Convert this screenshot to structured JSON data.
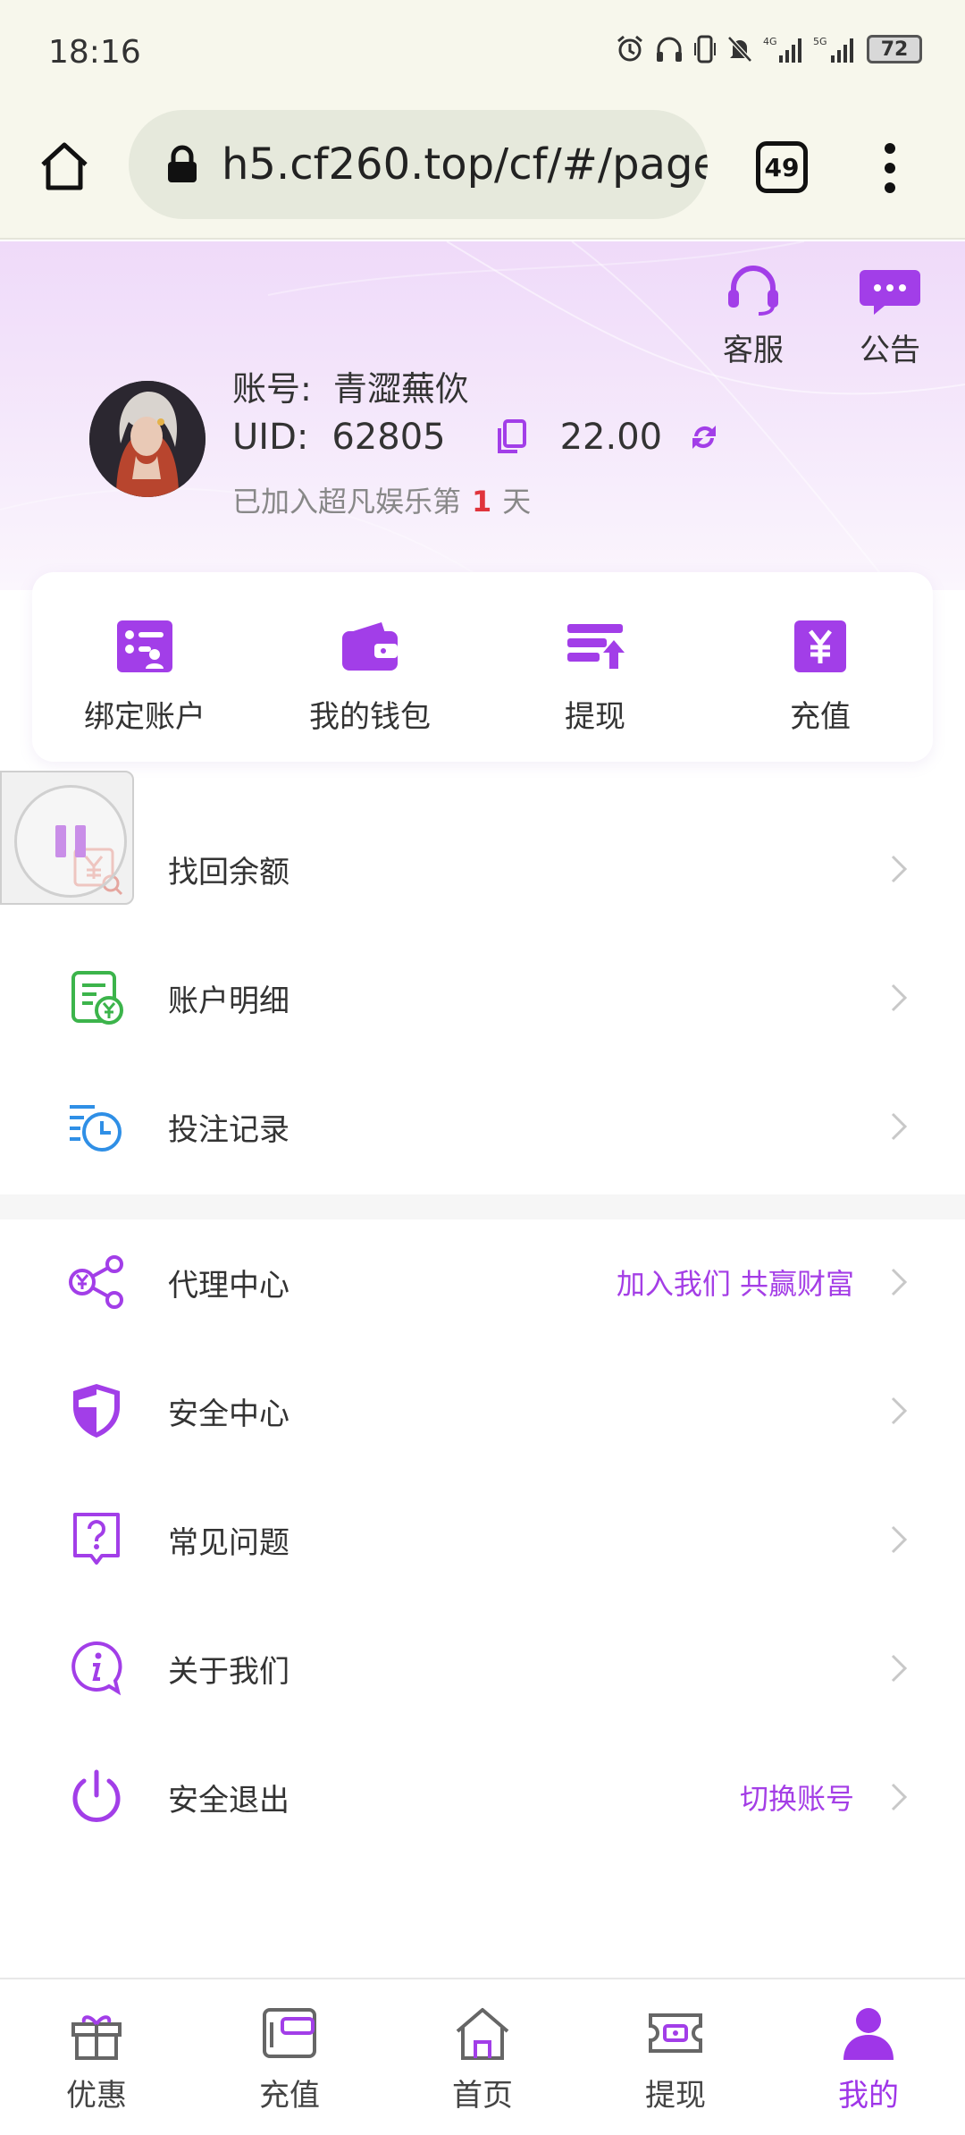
{
  "status_bar": {
    "time": "18:16",
    "network_1": "4G",
    "network_2": "5G",
    "battery": "72"
  },
  "browser": {
    "url": "h5.cf260.top/cf/#/page",
    "tab_count": "49"
  },
  "header_actions": [
    {
      "label": "客服",
      "icon": "headset-icon"
    },
    {
      "label": "公告",
      "icon": "chat-bubble-icon"
    }
  ],
  "profile": {
    "account_label": "账号:",
    "account_name": "青澀蕪佽",
    "uid_label": "UID:",
    "uid_value": "62805",
    "balance": "22.00",
    "joined_prefix": "已加入超凡娱乐第",
    "joined_days": "1",
    "joined_suffix": "天"
  },
  "quick_actions": [
    {
      "label": "绑定账户",
      "icon": "bind-account-icon"
    },
    {
      "label": "我的钱包",
      "icon": "wallet-icon"
    },
    {
      "label": "提现",
      "icon": "withdraw-icon"
    },
    {
      "label": "充值",
      "icon": "yen-card-icon"
    }
  ],
  "menu_group_1": [
    {
      "label": "找回余额",
      "icon": "recover-balance-icon",
      "extra": ""
    },
    {
      "label": "账户明细",
      "icon": "account-detail-icon",
      "extra": ""
    },
    {
      "label": "投注记录",
      "icon": "bet-record-icon",
      "extra": ""
    }
  ],
  "menu_group_2": [
    {
      "label": "代理中心",
      "icon": "agent-network-icon",
      "extra": "加入我们 共赢财富"
    },
    {
      "label": "安全中心",
      "icon": "shield-icon",
      "extra": ""
    },
    {
      "label": "常见问题",
      "icon": "question-icon",
      "extra": ""
    },
    {
      "label": "关于我们",
      "icon": "info-icon",
      "extra": ""
    },
    {
      "label": "安全退出",
      "icon": "power-icon",
      "extra": "切换账号"
    }
  ],
  "bottom_nav": [
    {
      "label": "优惠",
      "icon": "gift-icon",
      "active": false
    },
    {
      "label": "充值",
      "icon": "recharge-icon",
      "active": false
    },
    {
      "label": "首页",
      "icon": "home-icon",
      "active": false
    },
    {
      "label": "提现",
      "icon": "withdraw-ticket-icon",
      "active": false
    },
    {
      "label": "我的",
      "icon": "user-icon",
      "active": true
    }
  ],
  "colors": {
    "accent": "#9f36e8",
    "promo_text": "#a43ee6",
    "days_highlight": "#e0343c",
    "green_icon": "#3cb44b",
    "blue_icon": "#2f8fe6",
    "red_icon": "#e55a4a"
  }
}
